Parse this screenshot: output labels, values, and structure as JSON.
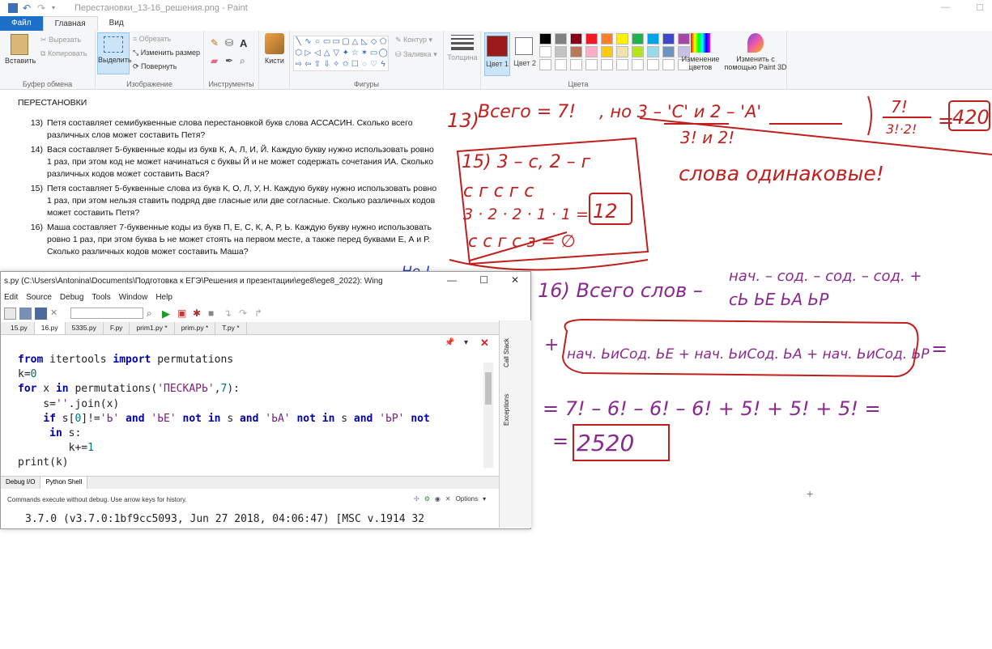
{
  "paint": {
    "title": "Перестановки_13-16_решения.png - Paint",
    "tabs": [
      "Файл",
      "Главная",
      "Вид"
    ],
    "clipboard": {
      "paste": "Вставить",
      "cut": "Вырезать",
      "copy": "Копировать",
      "label": "Буфер обмена"
    },
    "image": {
      "select": "Выделить",
      "crop": "Обрезать",
      "resize": "Изменить размер",
      "rotate": "Повернуть",
      "label": "Изображение"
    },
    "tools_label": "Инструменты",
    "brushes": "Кисти",
    "shapes": {
      "label": "Фигуры",
      "outline": "Контур",
      "fill": "Заливка"
    },
    "thickness": "Толщина",
    "color1": "Цвет 1",
    "color2": "Цвет 2",
    "colors_label": "Цвета",
    "edit_colors": "Изменение цветов",
    "paint3d": "Изменить с помощью Paint 3D",
    "palette": [
      "#000000",
      "#7f7f7f",
      "#880015",
      "#ed1c24",
      "#ff7f27",
      "#fff200",
      "#22b14c",
      "#00a2e8",
      "#3f48cc",
      "#a349a4",
      "#ffffff",
      "#c3c3c3",
      "#b97a57",
      "#ffaec9",
      "#ffc90e",
      "#efe4b0",
      "#b5e61d",
      "#99d9ea",
      "#7092be",
      "#c8bfe7"
    ],
    "color1_value": "#9b1b1b",
    "color2_value": "#ffffff"
  },
  "doc": {
    "title": "ПЕРЕСТАНОВКИ",
    "tasks": [
      {
        "num": "13)",
        "text": "Петя составляет семибуквенные слова перестановкой букв слова АССАСИН. Сколько всего различных слов может составить Петя?"
      },
      {
        "num": "14)",
        "text": "Вася составляет 5-буквенные коды из букв К, А, Л, И, Й. Каждую букву нужно использовать ровно 1 раз, при этом код не может начинаться с буквы Й и не может содержать сочетания ИА. Сколько различных кодов может составить Вася?"
      },
      {
        "num": "15)",
        "text": "Петя составляет 5-буквенные слова из букв К, О, Л, У, Н. Каждую букву нужно использовать ровно 1 раз, при этом нельзя ставить подряд две гласные или две согласные. Сколько различных кодов может составить Петя?"
      },
      {
        "num": "16)",
        "text": "Маша составляет 7-буквенные коды из букв П, Е, С, К, А, Р, Ь. Каждую букву нужно использовать ровно 1 раз, при этом буква Ь не может стоять на первом месте, а также перед буквами Е, А и Р. Сколько различных кодов может составить Маша?"
      }
    ]
  },
  "hand": {
    "t13a": "13)",
    "t13b": "Всего = 7!",
    "t13c": ", но 3 – 'С'  и  2 – 'А'",
    "t13d": "3!        и       2!",
    "t13frac_top": "7!",
    "t13frac_bot": "3!·2!",
    "t13eq": "=",
    "t13ans": "420",
    "same": "слова одинаковые!",
    "t15a": "15) 3 – с, 2 – г",
    "t15b": "с г с г с",
    "t15c": "3 · 2 · 2 · 1 · 1 =",
    "t15ans": "12",
    "t15d": "с с г с з = ∅",
    "t16a": "16) Всего слов –",
    "t16b": "нач. – сод. – сод. – сод. +",
    "t16c": "сЬ       ЬЕ      ЬА     ЬР",
    "t16d": "+",
    "t16e": "нач. ЬиСод. ЬЕ + нач. ЬиСод. ЬА + нач. ЬиСод. ЬР",
    "t16f": "=",
    "t16g": "= 7! – 6! – 6! – 6! + 5! + 5! + 5! =",
    "t16h": "=",
    "t16ans": "2520",
    "wing_marks": "Но !"
  },
  "wing": {
    "title": "s.py (C:\\Users\\Antonina\\Documents\\Подготовка к ЕГЭ\\Решения и презентации\\ege8\\ege8_2022): Wing",
    "menu": [
      "Edit",
      "Source",
      "Debug",
      "Tools",
      "Window",
      "Help"
    ],
    "file_tabs": [
      "15.py",
      "16.py",
      "5335.py",
      "F.py",
      "prim1.py *",
      "prim.py *",
      "T.py *"
    ],
    "active_tab": "16.py",
    "side_tabs": [
      "Call Stack",
      "Exceptions"
    ],
    "bottom_tabs": [
      "Debug I/O",
      "Python Shell"
    ],
    "shell_info": "Commands execute without debug.  Use arrow keys for history.",
    "options": "Options",
    "shell_line": "3.7.0 (v3.7.0:1bf9cc5093, Jun 27 2018, 04:06:47) [MSC v.1914 32"
  }
}
